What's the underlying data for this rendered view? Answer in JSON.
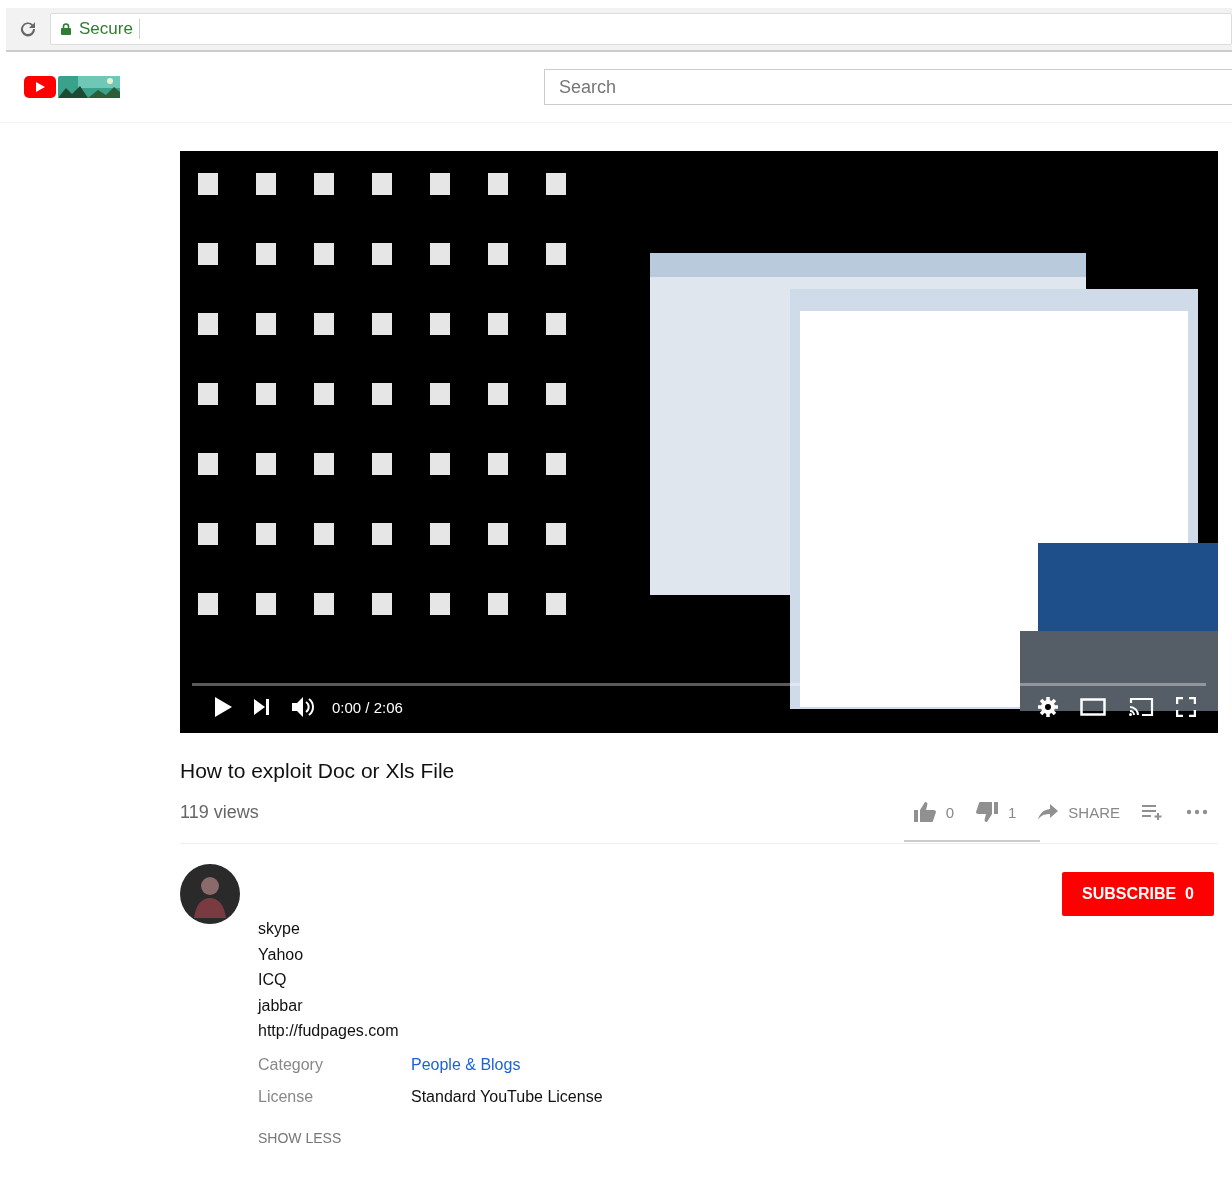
{
  "browser": {
    "secure_label": "Secure"
  },
  "header": {
    "search": {
      "placeholder": "Search"
    }
  },
  "player": {
    "time": "0:00 / 2:06",
    "level": 0
  },
  "video": {
    "title": "How to exploit Doc or Xls File",
    "views": "119 views",
    "actions": [
      {
        "kind": "like",
        "label": "0"
      },
      {
        "kind": "dislike",
        "label": "1"
      },
      {
        "kind": "share",
        "label": "SHARE"
      },
      {
        "kind": "add"
      },
      {
        "kind": "more"
      }
    ]
  },
  "channel": {
    "subscribe": "SUBSCRIBE",
    "subscribers": "0"
  },
  "description": {
    "lines": [
      "skype",
      "Yahoo",
      "ICQ",
      "jabbar",
      "http://fudpages.com"
    ],
    "meta": [
      {
        "label": "Category",
        "value": "People & Blogs",
        "kind": "link"
      },
      {
        "label": "License",
        "value": "Standard YouTube License",
        "kind": "text"
      }
    ],
    "toggle": "SHOW LESS"
  }
}
